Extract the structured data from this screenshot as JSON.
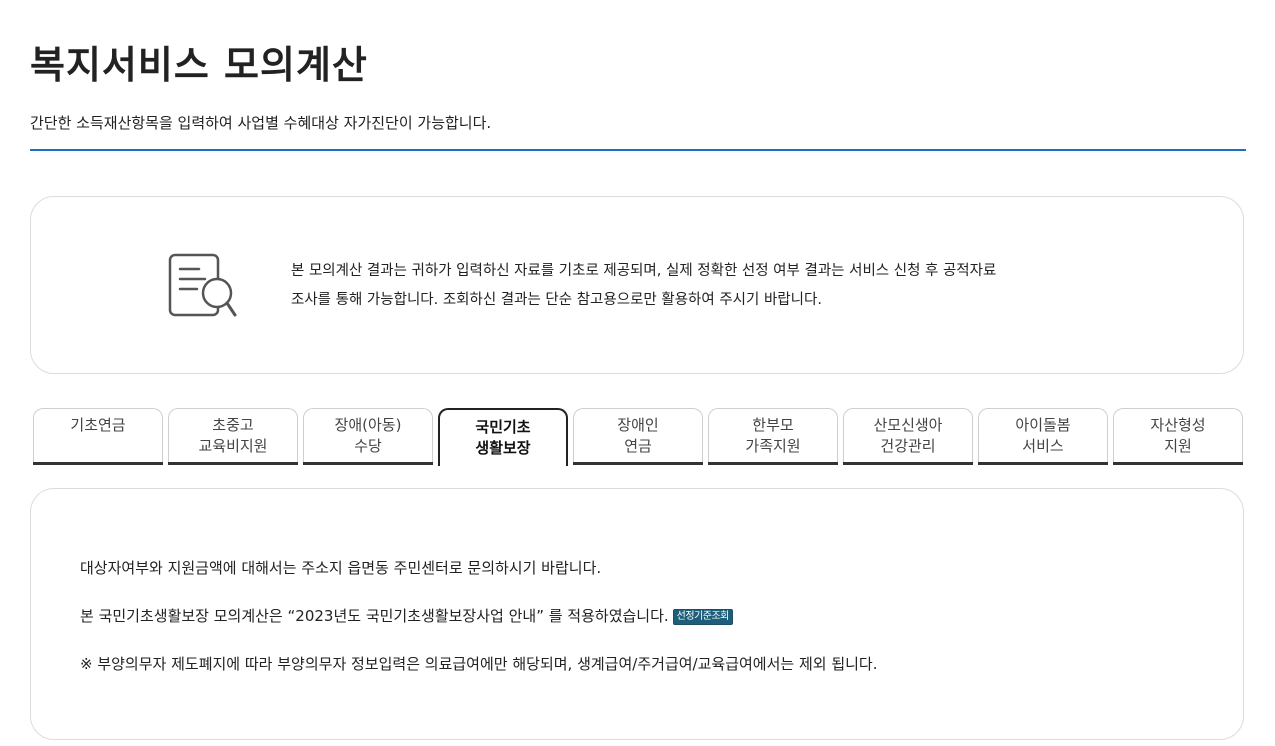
{
  "header": {
    "title": "복지서비스 모의계산",
    "description": "간단한 소득재산항목을 입력하여 사업별 수혜대상 자가진단이 가능합니다.",
    "accent_color": "#1a6fc3"
  },
  "notice": {
    "icon": "document-search-icon",
    "line1": "본 모의계산 결과는 귀하가 입력하신 자료를 기초로 제공되며, 실제 정확한 선정 여부 결과는 서비스 신청 후 공적자료",
    "line2": "조사를 통해 가능합니다. 조회하신 결과는 단순 참고용으로만 활용하여 주시기 바랍니다."
  },
  "tabs": [
    {
      "line1": "기초연금",
      "line2": ""
    },
    {
      "line1": "초중고",
      "line2": "교육비지원"
    },
    {
      "line1": "장애(아동)",
      "line2": "수당"
    },
    {
      "line1": "국민기초",
      "line2": "생활보장",
      "active": true
    },
    {
      "line1": "장애인",
      "line2": "연금"
    },
    {
      "line1": "한부모",
      "line2": "가족지원"
    },
    {
      "line1": "산모신생아",
      "line2": "건강관리"
    },
    {
      "line1": "아이돌봄",
      "line2": "서비스"
    },
    {
      "line1": "자산형성",
      "line2": "지원"
    }
  ],
  "info": {
    "line1": "대상자여부와 지원금액에 대해서는 주소지 읍면동 주민센터로 문의하시기 바랍니다.",
    "line2": "본 국민기초생활보장 모의계산은 “2023년도 국민기초생활보장사업 안내” 를 적용하였습니다.",
    "criteria_button": "선정기준조회",
    "criteria_button_color": "#1d5f7a",
    "line3": "※ 부양의무자 제도폐지에 따라 부양의무자 정보입력은 의료급여에만 해당되며, 생계급여/주거급여/교육급여에서는 제외 됩니다."
  }
}
